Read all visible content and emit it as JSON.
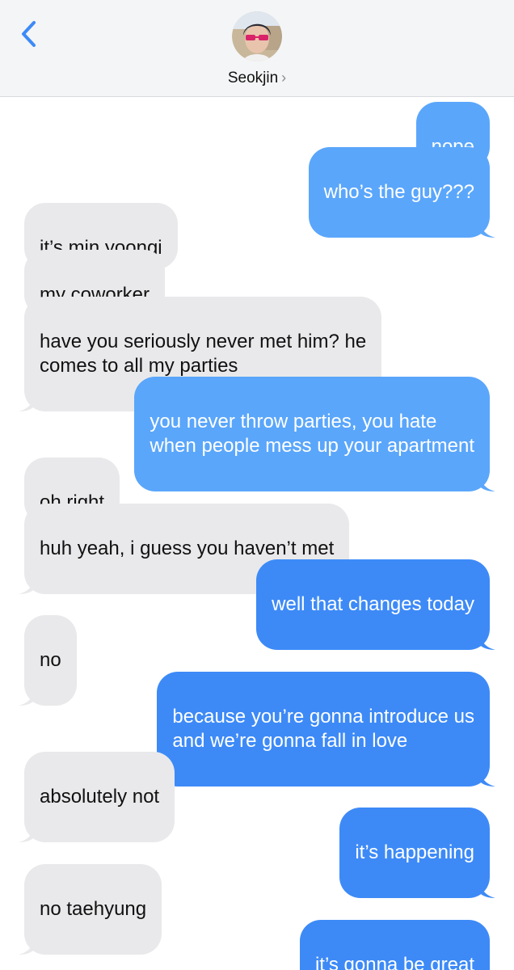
{
  "header": {
    "back_icon": "chevron-left-icon",
    "contact_name": "Seokjin",
    "chevron": "›",
    "accent": "#3d8af7"
  },
  "messages": [
    {
      "side": "sent",
      "text": "nope"
    },
    {
      "side": "sent",
      "text": "who’s the guy???"
    },
    {
      "side": "recv",
      "text": "it’s min yoongi"
    },
    {
      "side": "recv",
      "text": "my coworker"
    },
    {
      "side": "recv",
      "text": "have you seriously never met him? he\ncomes to all my parties"
    },
    {
      "side": "sent",
      "text": "you never throw parties, you hate\nwhen people mess up your apartment"
    },
    {
      "side": "recv",
      "text": "oh right"
    },
    {
      "side": "recv",
      "text": "huh yeah, i guess you haven’t met"
    },
    {
      "side": "sent",
      "text": "well that changes today"
    },
    {
      "side": "recv",
      "text": "no"
    },
    {
      "side": "sent",
      "text": "because you’re gonna introduce us\nand we’re gonna fall in love"
    },
    {
      "side": "recv",
      "text": "absolutely not"
    },
    {
      "side": "sent",
      "text": "it’s happening"
    },
    {
      "side": "recv",
      "text": "no taehyung"
    },
    {
      "side": "sent",
      "text": "it’s gonna be great"
    }
  ],
  "colors": {
    "sent_bubble": "#3d8af7",
    "recv_bubble": "#e9e9eb",
    "header_bg": "#f4f5f7"
  }
}
